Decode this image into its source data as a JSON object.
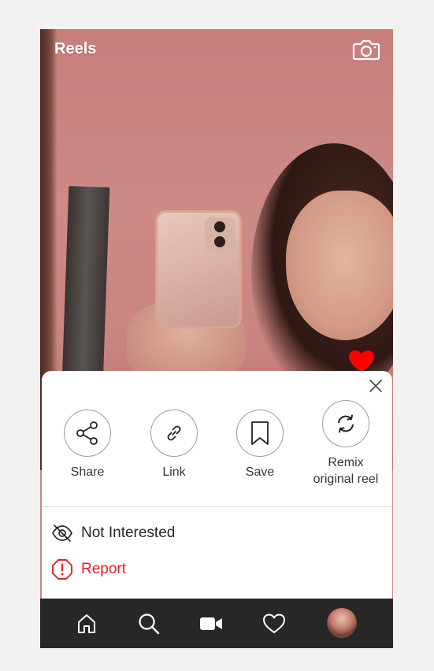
{
  "header": {
    "title": "Reels",
    "camera_icon": "camera-icon"
  },
  "sheet": {
    "close_icon": "close-icon",
    "actions": [
      {
        "label": "Share",
        "icon": "share-icon"
      },
      {
        "label": "Link",
        "icon": "link-icon"
      },
      {
        "label": "Save",
        "icon": "bookmark-icon"
      },
      {
        "label": "Remix\noriginal reel",
        "icon": "remix-icon"
      }
    ],
    "menu": [
      {
        "label": "Not Interested",
        "icon": "eye-slash-icon",
        "color": "#262626"
      },
      {
        "label": "Report",
        "icon": "report-icon",
        "color": "#ed1c24"
      }
    ]
  },
  "nav": {
    "items": [
      "home-icon",
      "search-icon",
      "reels-video-icon",
      "heart-icon",
      "profile-avatar"
    ]
  },
  "colors": {
    "accent_red": "#ff0000",
    "report_red": "#ed1c24",
    "nav_bg": "#272727"
  }
}
